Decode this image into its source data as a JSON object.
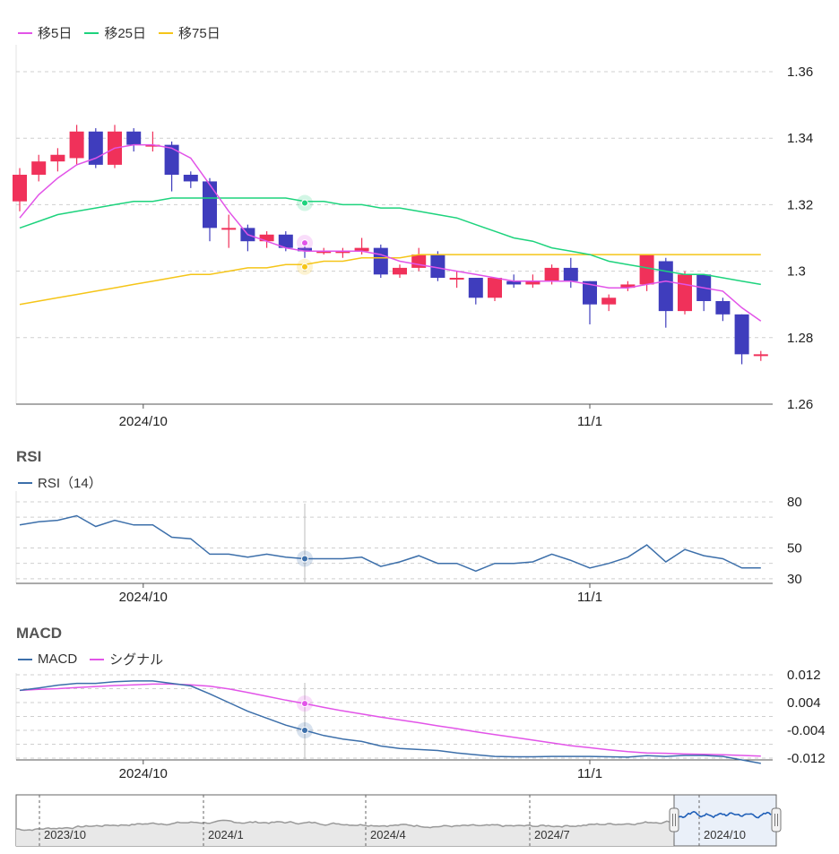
{
  "price_legend": [
    {
      "label": "移5日",
      "color": "#e254e8"
    },
    {
      "label": "移25日",
      "color": "#1dd37d"
    },
    {
      "label": "移75日",
      "color": "#f5c518"
    }
  ],
  "rsi": {
    "title": "RSI",
    "legend": "RSI（14）",
    "color": "#3c6faa"
  },
  "macd": {
    "title": "MACD",
    "legend_macd": "MACD",
    "legend_signal": "シグナル",
    "macd_color": "#3c6faa",
    "signal_color": "#e254e8"
  },
  "colors": {
    "up": "#f0315a",
    "down": "#3f3dbd",
    "grid": "#cfcfcf"
  },
  "navigator": {
    "labels": [
      "2023/10",
      "2024/1",
      "2024/4",
      "2024/7",
      "2024/10"
    ]
  },
  "chart_data": [
    {
      "type": "candlestick",
      "ylim": [
        1.26,
        1.36
      ],
      "yticks": [
        "1.36",
        "1.34",
        "1.32",
        "1.3",
        "1.28",
        "1.26"
      ],
      "xticks": [
        {
          "label": "2024/10",
          "index": 6.5
        },
        {
          "label": "11/1",
          "index": 30
        }
      ],
      "candles": [
        [
          1.321,
          1.329,
          1.318,
          1.331
        ],
        [
          1.329,
          1.333,
          1.327,
          1.335
        ],
        [
          1.333,
          1.335,
          1.33,
          1.337
        ],
        [
          1.334,
          1.342,
          1.332,
          1.344
        ],
        [
          1.342,
          1.332,
          1.331,
          1.343
        ],
        [
          1.332,
          1.342,
          1.331,
          1.344
        ],
        [
          1.342,
          1.338,
          1.336,
          1.343
        ],
        [
          1.338,
          1.338,
          1.336,
          1.342
        ],
        [
          1.338,
          1.329,
          1.324,
          1.339
        ],
        [
          1.329,
          1.327,
          1.325,
          1.33
        ],
        [
          1.327,
          1.313,
          1.309,
          1.328
        ],
        [
          1.313,
          1.313,
          1.307,
          1.317
        ],
        [
          1.313,
          1.309,
          1.306,
          1.314
        ],
        [
          1.309,
          1.311,
          1.307,
          1.312
        ],
        [
          1.311,
          1.307,
          1.306,
          1.312
        ],
        [
          1.307,
          1.306,
          1.304,
          1.309
        ],
        [
          1.306,
          1.306,
          1.305,
          1.307
        ],
        [
          1.306,
          1.306,
          1.304,
          1.307
        ],
        [
          1.306,
          1.307,
          1.305,
          1.31
        ],
        [
          1.307,
          1.299,
          1.298,
          1.308
        ],
        [
          1.299,
          1.301,
          1.298,
          1.302
        ],
        [
          1.301,
          1.305,
          1.3,
          1.307
        ],
        [
          1.305,
          1.298,
          1.297,
          1.306
        ],
        [
          1.298,
          1.298,
          1.295,
          1.3
        ],
        [
          1.298,
          1.292,
          1.29,
          1.298
        ],
        [
          1.292,
          1.298,
          1.291,
          1.298
        ],
        [
          1.297,
          1.296,
          1.295,
          1.299
        ],
        [
          1.296,
          1.297,
          1.295,
          1.299
        ],
        [
          1.297,
          1.301,
          1.296,
          1.302
        ],
        [
          1.301,
          1.297,
          1.295,
          1.304
        ],
        [
          1.297,
          1.29,
          1.284,
          1.297
        ],
        [
          1.29,
          1.292,
          1.288,
          1.293
        ],
        [
          1.295,
          1.296,
          1.294,
          1.297
        ],
        [
          1.296,
          1.305,
          1.294,
          1.305
        ],
        [
          1.303,
          1.288,
          1.283,
          1.304
        ],
        [
          1.288,
          1.299,
          1.287,
          1.3
        ],
        [
          1.299,
          1.291,
          1.288,
          1.299
        ],
        [
          1.291,
          1.287,
          1.285,
          1.292
        ],
        [
          1.287,
          1.275,
          1.272,
          1.287
        ],
        [
          1.275,
          1.275,
          1.273,
          1.276
        ]
      ],
      "ma5": [
        1.316,
        1.323,
        1.328,
        1.332,
        1.334,
        1.337,
        1.338,
        1.338,
        1.337,
        1.334,
        1.326,
        1.318,
        1.311,
        1.309,
        1.307,
        1.306,
        1.306,
        1.306,
        1.306,
        1.305,
        1.303,
        1.302,
        1.301,
        1.3,
        1.299,
        1.298,
        1.297,
        1.297,
        1.297,
        1.297,
        1.296,
        1.295,
        1.295,
        1.296,
        1.297,
        1.296,
        1.295,
        1.294,
        1.289,
        1.285
      ],
      "ma25": [
        1.313,
        1.315,
        1.317,
        1.318,
        1.319,
        1.32,
        1.321,
        1.321,
        1.322,
        1.322,
        1.322,
        1.322,
        1.322,
        1.322,
        1.322,
        1.321,
        1.321,
        1.32,
        1.32,
        1.319,
        1.319,
        1.318,
        1.317,
        1.316,
        1.314,
        1.312,
        1.31,
        1.309,
        1.307,
        1.306,
        1.305,
        1.303,
        1.302,
        1.301,
        1.3,
        1.299,
        1.299,
        1.298,
        1.297,
        1.296
      ],
      "ma75": [
        1.29,
        1.291,
        1.292,
        1.293,
        1.294,
        1.295,
        1.296,
        1.297,
        1.298,
        1.299,
        1.299,
        1.3,
        1.301,
        1.301,
        1.302,
        1.302,
        1.303,
        1.303,
        1.304,
        1.304,
        1.304,
        1.305,
        1.305,
        1.305,
        1.305,
        1.305,
        1.305,
        1.305,
        1.305,
        1.305,
        1.305,
        1.305,
        1.305,
        1.305,
        1.305,
        1.305,
        1.305,
        1.305,
        1.305,
        1.305
      ],
      "hover_index": 15,
      "hover_values": {
        "ma5": 1.3085,
        "ma25": 1.3205,
        "ma75": 1.3013
      }
    },
    {
      "type": "line",
      "name": "RSI（14）",
      "ylim": [
        27,
        87
      ],
      "yticks": [
        "80",
        "50",
        "30"
      ],
      "xticks": [
        {
          "label": "2024/10",
          "index": 6.5
        },
        {
          "label": "11/1",
          "index": 30
        }
      ],
      "values": [
        65,
        67,
        68,
        71,
        64,
        68,
        65,
        65,
        57,
        56,
        46,
        46,
        44,
        46,
        44,
        43,
        43,
        43,
        44,
        38,
        41,
        45,
        40,
        40,
        35,
        40,
        40,
        41,
        46,
        42,
        37,
        40,
        44,
        52,
        41,
        49,
        45,
        43,
        37,
        37
      ],
      "hover_index": 15,
      "hover_value": 43
    },
    {
      "type": "line",
      "ylim": [
        -0.0125,
        0.0125
      ],
      "yticks": [
        "0.012",
        "0.004",
        "-0.004",
        "-0.012"
      ],
      "xticks": [
        {
          "label": "2024/10",
          "index": 6.5
        },
        {
          "label": "11/1",
          "index": 30
        }
      ],
      "series": [
        {
          "name": "MACD",
          "values": [
            0.0075,
            0.0082,
            0.009,
            0.0095,
            0.0095,
            0.01,
            0.0102,
            0.0102,
            0.0095,
            0.0088,
            0.0065,
            0.004,
            0.0015,
            -0.0005,
            -0.0025,
            -0.004,
            -0.0055,
            -0.0065,
            -0.0072,
            -0.0085,
            -0.0092,
            -0.0095,
            -0.0098,
            -0.0105,
            -0.011,
            -0.0115,
            -0.0116,
            -0.0116,
            -0.0115,
            -0.0115,
            -0.0115,
            -0.0116,
            -0.0117,
            -0.0113,
            -0.0115,
            -0.0112,
            -0.0112,
            -0.0115,
            -0.0125,
            -0.0135
          ]
        },
        {
          "name": "シグナル",
          "values": [
            0.0075,
            0.0078,
            0.008,
            0.0083,
            0.0086,
            0.0089,
            0.0091,
            0.0093,
            0.0093,
            0.0091,
            0.0087,
            0.0079,
            0.0069,
            0.0058,
            0.0047,
            0.0037,
            0.0026,
            0.0016,
            0.0007,
            -0.0002,
            -0.001,
            -0.0018,
            -0.0027,
            -0.0035,
            -0.0044,
            -0.0052,
            -0.006,
            -0.0068,
            -0.0076,
            -0.0084,
            -0.009,
            -0.0096,
            -0.0101,
            -0.0105,
            -0.0106,
            -0.0108,
            -0.0109,
            -0.011,
            -0.0112,
            -0.0114
          ]
        }
      ],
      "hover_index": 15
    }
  ]
}
